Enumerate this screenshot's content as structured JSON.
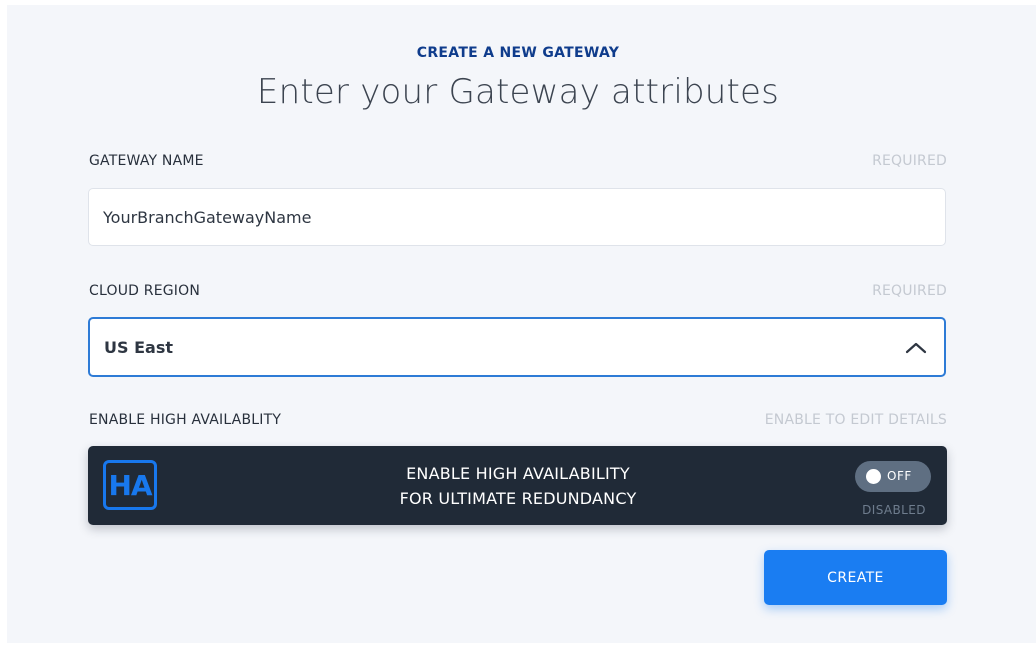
{
  "header": {
    "eyebrow": "CREATE A NEW GATEWAY",
    "title": "Enter your Gateway attributes"
  },
  "gateway_name": {
    "label": "GATEWAY NAME",
    "hint": "REQUIRED",
    "value": "YourBranchGatewayName"
  },
  "cloud_region": {
    "label": "CLOUD REGION",
    "hint": "REQUIRED",
    "selected": "US East",
    "icon": "chevron-up-icon"
  },
  "high_availability": {
    "label": "ENABLE HIGH AVAILABLITY",
    "hint": "ENABLE TO EDIT DETAILS",
    "logo_text": "HA",
    "line1": "ENABLE HIGH AVAILABILITY",
    "line2": "FOR ULTIMATE REDUNDANCY",
    "toggle_label": "OFF",
    "toggle_status": "DISABLED"
  },
  "actions": {
    "create_label": "CREATE"
  },
  "colors": {
    "accent": "#1a7df2",
    "brand_dark": "#0f3c8c",
    "ha_bar": "#202a37"
  }
}
